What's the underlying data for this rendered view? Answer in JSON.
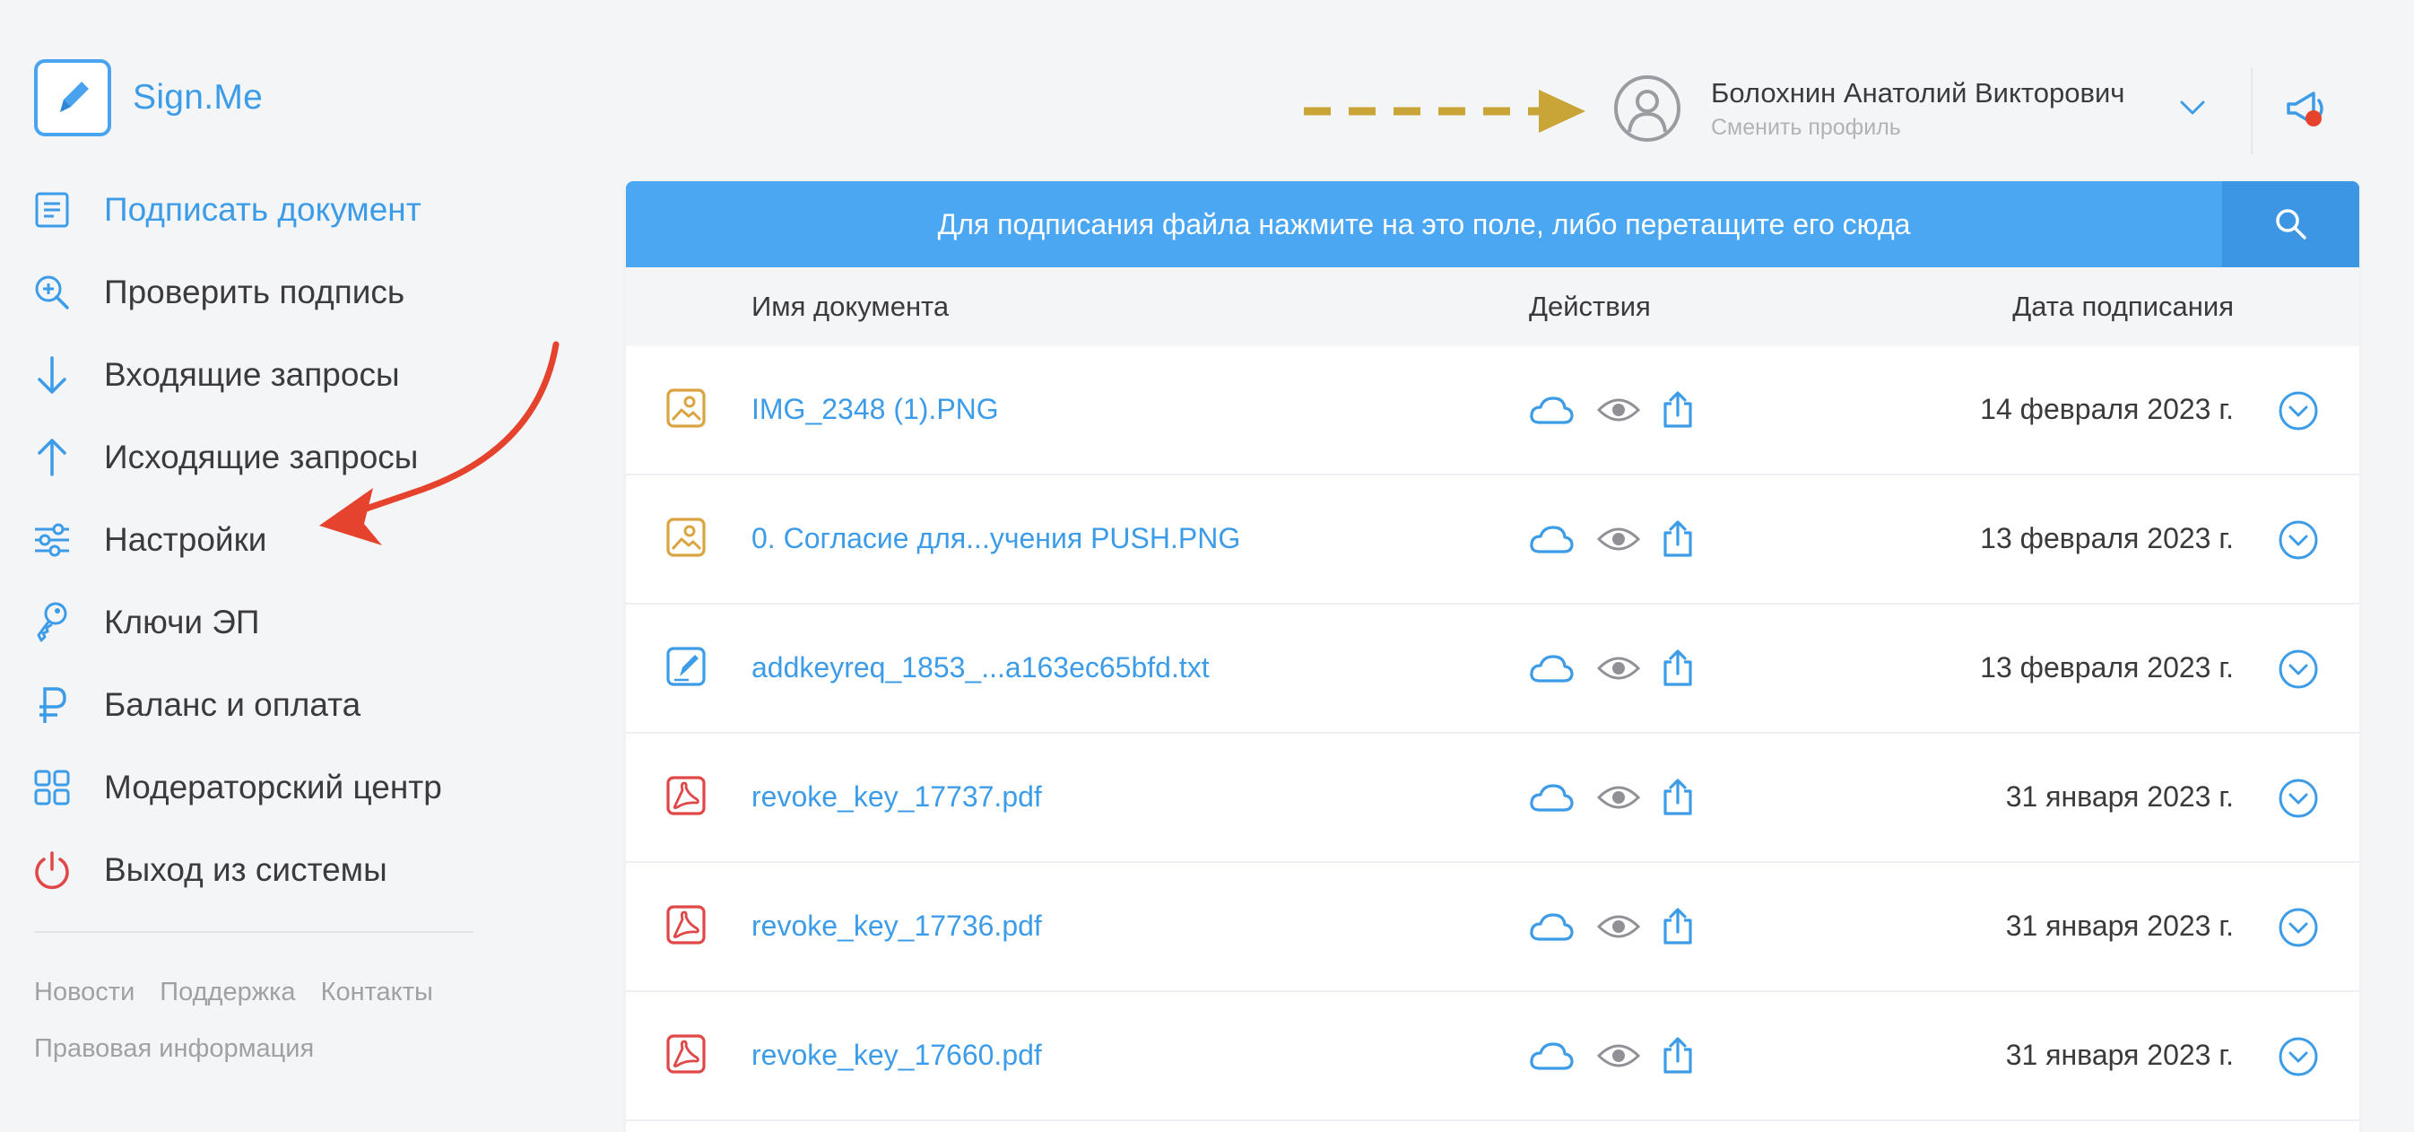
{
  "brand": {
    "name": "Sign.Me",
    "accent": "#3d9ce8"
  },
  "sidebar": {
    "items": [
      {
        "label": "Подписать документ",
        "icon": "document-icon",
        "active": true
      },
      {
        "label": "Проверить подпись",
        "icon": "zoom-check-icon",
        "active": false
      },
      {
        "label": "Входящие запросы",
        "icon": "arrow-down-icon",
        "active": false
      },
      {
        "label": "Исходящие запросы",
        "icon": "arrow-up-icon",
        "active": false
      },
      {
        "label": "Настройки",
        "icon": "sliders-icon",
        "active": false
      },
      {
        "label": "Ключи ЭП",
        "icon": "key-icon",
        "active": false
      },
      {
        "label": "Баланс и оплата",
        "icon": "ruble-icon",
        "active": false
      },
      {
        "label": "Модераторский центр",
        "icon": "grid-icon",
        "active": false
      },
      {
        "label": "Выход из системы",
        "icon": "power-icon",
        "active": false
      }
    ],
    "footer": {
      "news": "Новости",
      "support": "Поддержка",
      "contacts": "Контакты",
      "legal": "Правовая информация"
    }
  },
  "header": {
    "profile_name": "Болохнин Анатолий Викторович",
    "profile_switch": "Сменить профиль"
  },
  "main": {
    "dropzone_text": "Для подписания файла нажмите на это поле, либо перетащите его сюда",
    "columns": {
      "name": "Имя документа",
      "actions": "Действия",
      "date": "Дата подписания"
    },
    "rows": [
      {
        "name": "IMG_2348 (1).PNG",
        "type": "image",
        "date": "14 февраля 2023 г."
      },
      {
        "name": "0. Согласие для...учения PUSH.PNG",
        "type": "image",
        "date": "13 февраля 2023 г."
      },
      {
        "name": "addkeyreq_1853_...a163ec65bfd.txt",
        "type": "text",
        "date": "13 февраля 2023 г."
      },
      {
        "name": "revoke_key_17737.pdf",
        "type": "pdf",
        "date": "31 января 2023 г."
      },
      {
        "name": "revoke_key_17736.pdf",
        "type": "pdf",
        "date": "31 января 2023 г."
      },
      {
        "name": "revoke_key_17660.pdf",
        "type": "pdf",
        "date": "31 января 2023 г."
      }
    ]
  },
  "colors": {
    "accent": "#3d9ce8",
    "dropzone": "#4ca7f3",
    "image_icon": "#d9a441",
    "pdf_icon": "#e04848",
    "annotation_red": "#e5432e",
    "annotation_gold": "#c9a437"
  }
}
